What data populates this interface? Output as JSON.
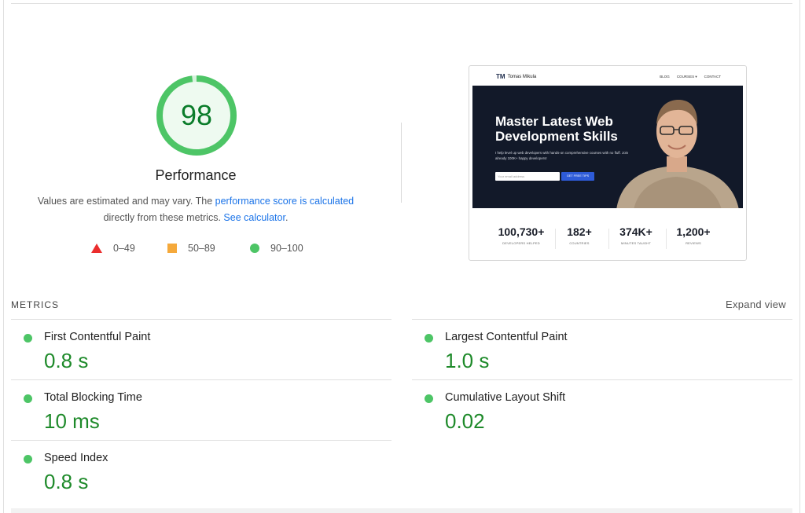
{
  "gauge": {
    "score": "98",
    "score_value": 98,
    "title": "Performance",
    "color": "#0cce6b"
  },
  "description": {
    "text_before": "Values are estimated and may vary. The ",
    "link_score": "performance score is calculated",
    "text_middle": " directly from these metrics. ",
    "link_calc": "See calculator",
    "text_after": "."
  },
  "legend": [
    {
      "icon": "triangle-red-icon",
      "label": "0–49",
      "color": "#eb2d2d"
    },
    {
      "icon": "square-orange-icon",
      "label": "50–89",
      "color": "#f5a93b"
    },
    {
      "icon": "circle-green-icon",
      "label": "90–100",
      "color": "#4dc566"
    }
  ],
  "screenshot": {
    "logo_text": "Tomas Mikula",
    "logo_mark": "TM",
    "nav": [
      "BLOG",
      "COURSES ▾",
      "CONTACT"
    ],
    "hero_title": "Master Latest Web Development Skills",
    "hero_sub": "I help level up web developers with hands-on comprehensive courses with no fluff. Join already 100K+ happy developers!",
    "input_placeholder": "Your email address",
    "button_label": "GET FREE TIPS",
    "stats": [
      {
        "value": "100,730+",
        "label": "DEVELOPERS HELPED"
      },
      {
        "value": "182+",
        "label": "COUNTRIES"
      },
      {
        "value": "374K+",
        "label": "MINUTES TAUGHT"
      },
      {
        "value": "1,200+",
        "label": "REVIEWS"
      }
    ]
  },
  "metrics": {
    "title": "METRICS",
    "expand_label": "Expand view",
    "items": [
      {
        "name": "First Contentful Paint",
        "value": "0.8 s"
      },
      {
        "name": "Largest Contentful Paint",
        "value": "1.0 s"
      },
      {
        "name": "Total Blocking Time",
        "value": "10 ms"
      },
      {
        "name": "Cumulative Layout Shift",
        "value": "0.02"
      },
      {
        "name": "Speed Index",
        "value": "0.8 s"
      }
    ]
  }
}
